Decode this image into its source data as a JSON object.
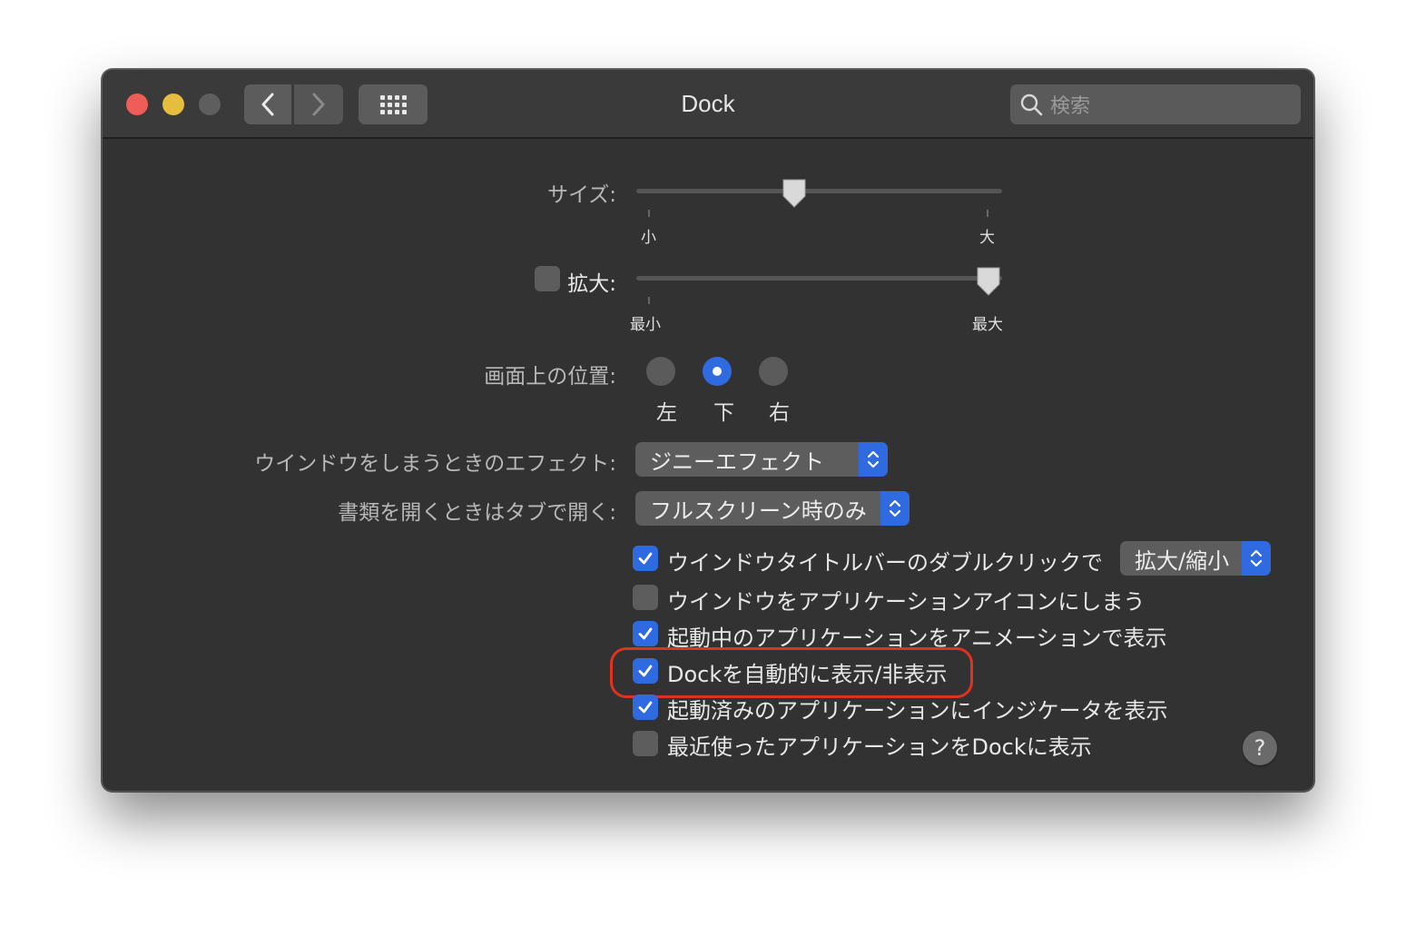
{
  "window": {
    "title": "Dock",
    "search_placeholder": "検索"
  },
  "size": {
    "label": "サイズ:",
    "min_label": "小",
    "max_label": "大",
    "value": 0.43
  },
  "magnification": {
    "label": "拡大:",
    "checked": false,
    "min_label": "最小",
    "max_label": "最大",
    "value": 1.0
  },
  "position": {
    "label": "画面上の位置:",
    "options": [
      "左",
      "下",
      "右"
    ],
    "selected": "下"
  },
  "minimize_effect": {
    "label": "ウインドウをしまうときのエフェクト:",
    "value": "ジニーエフェクト"
  },
  "tabs": {
    "label": "書類を開くときはタブで開く:",
    "value": "フルスクリーン時のみ"
  },
  "double_click": {
    "label": "ウインドウタイトルバーのダブルクリックで",
    "value": "拡大/縮小",
    "checked": true
  },
  "options": [
    {
      "label": "ウインドウをアプリケーションアイコンにしまう",
      "checked": false
    },
    {
      "label": "起動中のアプリケーションをアニメーションで表示",
      "checked": true
    },
    {
      "label": "Dockを自動的に表示/非表示",
      "checked": true,
      "highlighted": true
    },
    {
      "label": "起動済みのアプリケーションにインジケータを表示",
      "checked": true
    },
    {
      "label": "最近使ったアプリケーションをDockに表示",
      "checked": false
    }
  ],
  "help_label": "?",
  "colors": {
    "accent": "#2f6ae0",
    "highlight": "#e0331f",
    "close": "#ee5d57",
    "minimize": "#e5bd3f"
  }
}
